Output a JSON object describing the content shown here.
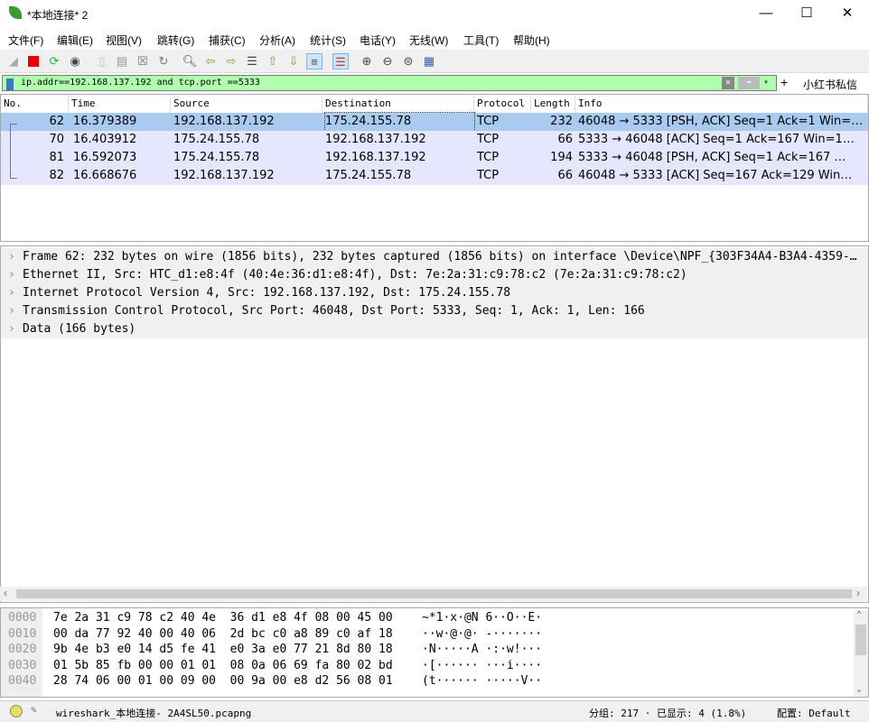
{
  "window": {
    "title": "*本地连接* 2",
    "minimize": "—",
    "maximize": "☐",
    "close": "✕"
  },
  "menu": [
    "文件(F)",
    "编辑(E)",
    "视图(V)",
    "跳转(G)",
    "捕获(C)",
    "分析(A)",
    "统计(S)",
    "电话(Y)",
    "无线(W)",
    "工具(T)",
    "帮助(H)"
  ],
  "filter": {
    "value": "ip.addr==192.168.137.192 and tcp.port ==5333",
    "clear": "✕",
    "apply": "➡",
    "dropdown": "▾",
    "add": "+",
    "saved_button": "小红书私信"
  },
  "columns": [
    "No.",
    "Time",
    "Source",
    "Destination",
    "Protocol",
    "Length",
    "Info"
  ],
  "packets": [
    {
      "no": "62",
      "time": "16.379389",
      "src": "192.168.137.192",
      "dst": "175.24.155.78",
      "proto": "TCP",
      "len": "232",
      "info": "46048 → 5333 [PSH, ACK] Seq=1 Ack=1 Win=…",
      "selected": true
    },
    {
      "no": "70",
      "time": "16.403912",
      "src": "175.24.155.78",
      "dst": "192.168.137.192",
      "proto": "TCP",
      "len": "66",
      "info": "5333 → 46048 [ACK] Seq=1 Ack=167 Win=1…"
    },
    {
      "no": "81",
      "time": "16.592073",
      "src": "175.24.155.78",
      "dst": "192.168.137.192",
      "proto": "TCP",
      "len": "194",
      "info": "5333 → 46048 [PSH, ACK] Seq=1 Ack=167 …"
    },
    {
      "no": "82",
      "time": "16.668676",
      "src": "192.168.137.192",
      "dst": "175.24.155.78",
      "proto": "TCP",
      "len": "66",
      "info": "46048 → 5333 [ACK] Seq=167 Ack=129 Win…"
    }
  ],
  "details": [
    "Frame 62: 232 bytes on wire (1856 bits), 232 bytes captured (1856 bits) on interface \\Device\\NPF_{303F34A4-B3A4-4359-…",
    "Ethernet II, Src: HTC_d1:e8:4f (40:4e:36:d1:e8:4f), Dst: 7e:2a:31:c9:78:c2 (7e:2a:31:c9:78:c2)",
    "Internet Protocol Version 4, Src: 192.168.137.192, Dst: 175.24.155.78",
    "Transmission Control Protocol, Src Port: 46048, Dst Port: 5333, Seq: 1, Ack: 1, Len: 166",
    "Data (166 bytes)"
  ],
  "bytes": [
    {
      "offset": "0000",
      "hex": "7e 2a 31 c9 78 c2 40 4e  36 d1 e8 4f 08 00 45 00",
      "ascii": "~*1·x·@N 6··O··E·"
    },
    {
      "offset": "0010",
      "hex": "00 da 77 92 40 00 40 06  2d bc c0 a8 89 c0 af 18",
      "ascii": "··w·@·@· -·······"
    },
    {
      "offset": "0020",
      "hex": "9b 4e b3 e0 14 d5 fe 41  e0 3a e0 77 21 8d 80 18",
      "ascii": "·N·····A ·:·w!···"
    },
    {
      "offset": "0030",
      "hex": "01 5b 85 fb 00 00 01 01  08 0a 06 69 fa 80 02 bd",
      "ascii": "·[······ ···i····"
    },
    {
      "offset": "0040",
      "hex": "28 74 06 00 01 00 09 00  00 9a 00 e8 d2 56 08 01",
      "ascii": "(t······ ·····V··"
    }
  ],
  "status": {
    "file": "wireshark_本地连接- 2A4SL50.pcapng",
    "packets": "分组: 217 · 已显示: 4 (1.8%)",
    "profile": "配置: Default"
  },
  "colors": {
    "filter_ok": "#afffaf",
    "row_bg": "#e7e6ff",
    "row_selected": "#a9cbf0"
  }
}
